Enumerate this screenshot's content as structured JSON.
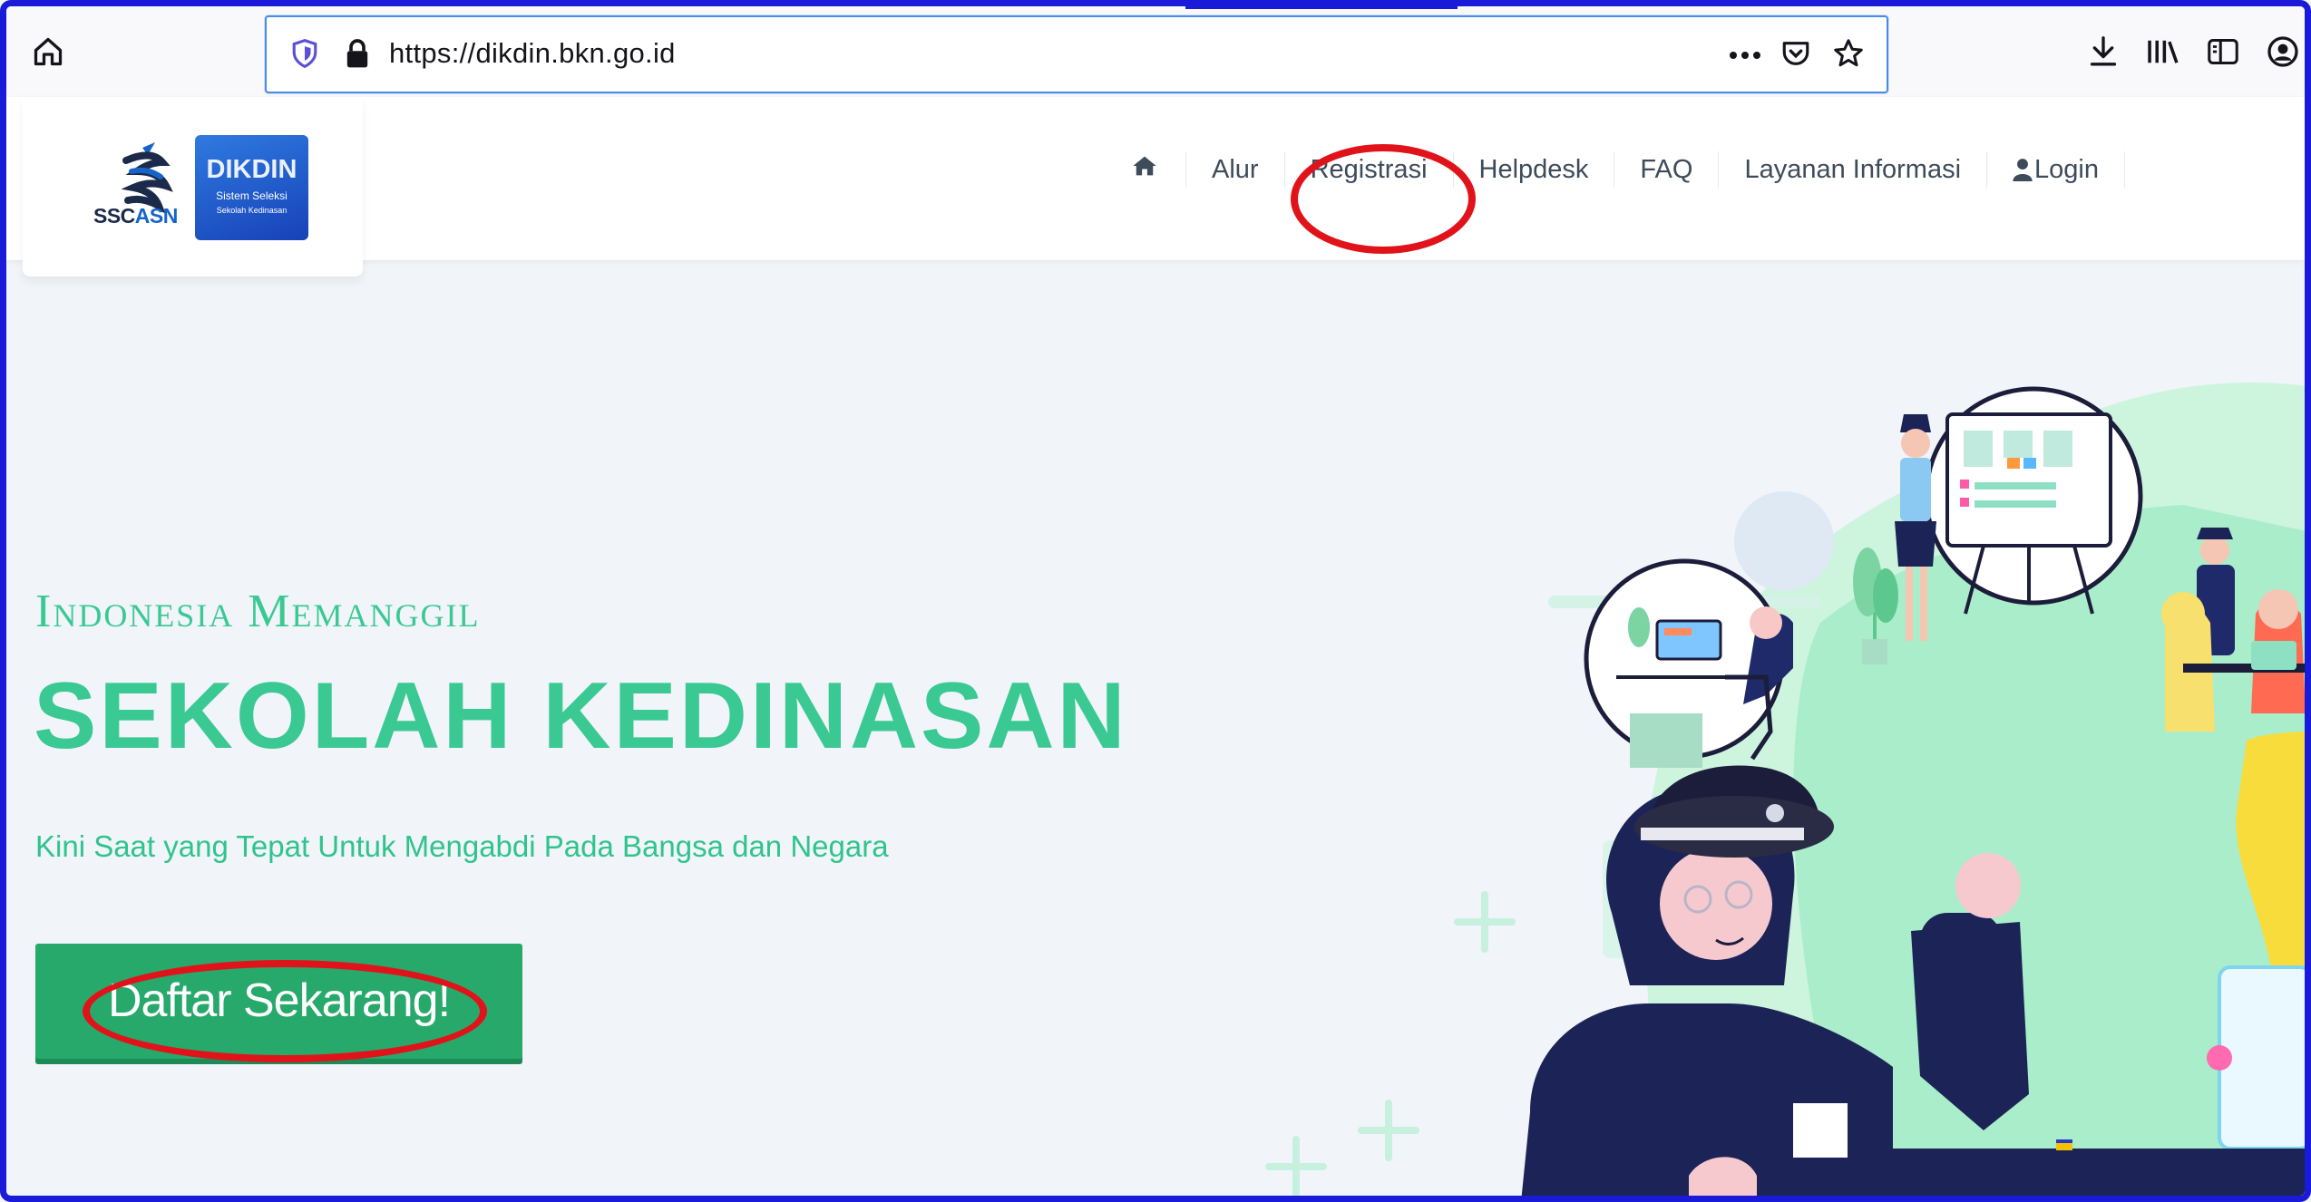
{
  "browser": {
    "url": "https://dikdin.bkn.go.id",
    "icons": {
      "home": "home-icon",
      "shield": "tracking-protection-shield-icon",
      "lock": "lock-icon",
      "more": "more-dots-icon",
      "pocket": "pocket-icon",
      "bookmark": "star-bookmark-icon",
      "download": "download-icon",
      "library": "library-icon",
      "sidebar": "sidebar-icon",
      "account": "account-icon"
    }
  },
  "logo": {
    "ssc_prefix": "SSC",
    "ssc_suffix": "ASN",
    "dikdin_title": "DIKDIN",
    "dikdin_line1": "Sistem Seleksi",
    "dikdin_line2": "Sekolah Kedinasan"
  },
  "nav": {
    "items": [
      {
        "label": "Alur"
      },
      {
        "label": "Registrasi"
      },
      {
        "label": "Helpdesk"
      },
      {
        "label": "FAQ"
      },
      {
        "label": "Layanan Informasi"
      },
      {
        "label": "Login"
      }
    ]
  },
  "hero": {
    "subtitle": "Indonesia Memanggil",
    "title": "SEKOLAH KEDINASAN",
    "description": "Kini Saat yang Tepat Untuk Mengabdi Pada Bangsa dan Negara",
    "cta": "Daftar Sekarang!"
  },
  "colors": {
    "accent_green": "#3ac993",
    "button_green": "#27a96b",
    "annotation_red": "#e1131a",
    "frame_blue": "#1a1ad9"
  }
}
